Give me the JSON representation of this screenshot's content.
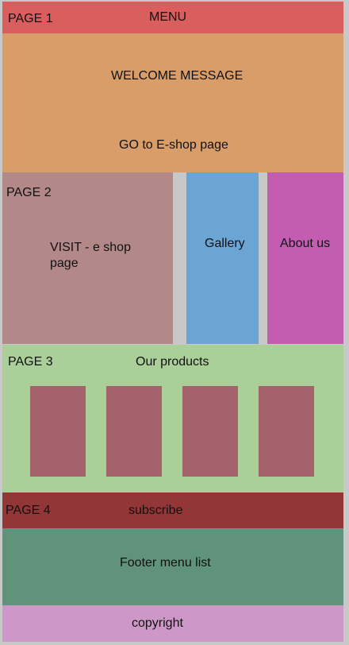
{
  "page1": {
    "label": "PAGE 1",
    "menu": "MENU",
    "welcome": "WELCOME MESSAGE",
    "eshop_link": "GO to E-shop page"
  },
  "page2": {
    "label": "PAGE 2",
    "visit": "VISIT - e shop page",
    "gallery": "Gallery",
    "about": "About us"
  },
  "page3": {
    "label": "PAGE 3",
    "title": "Our products"
  },
  "page4": {
    "label": "PAGE 4",
    "subscribe": "subscribe"
  },
  "footer": {
    "menu_list": "Footer menu list",
    "copyright": "copyright"
  },
  "colors": {
    "header": "#d95e5e",
    "hero": "#d89d68",
    "visit": "#b38888",
    "gallery": "#6aa5d4",
    "about": "#c25db2",
    "products": "#abcf98",
    "product_card": "#a5626a",
    "subscribe": "#923637",
    "footer": "#61937a",
    "copyright": "#cd98c8"
  }
}
